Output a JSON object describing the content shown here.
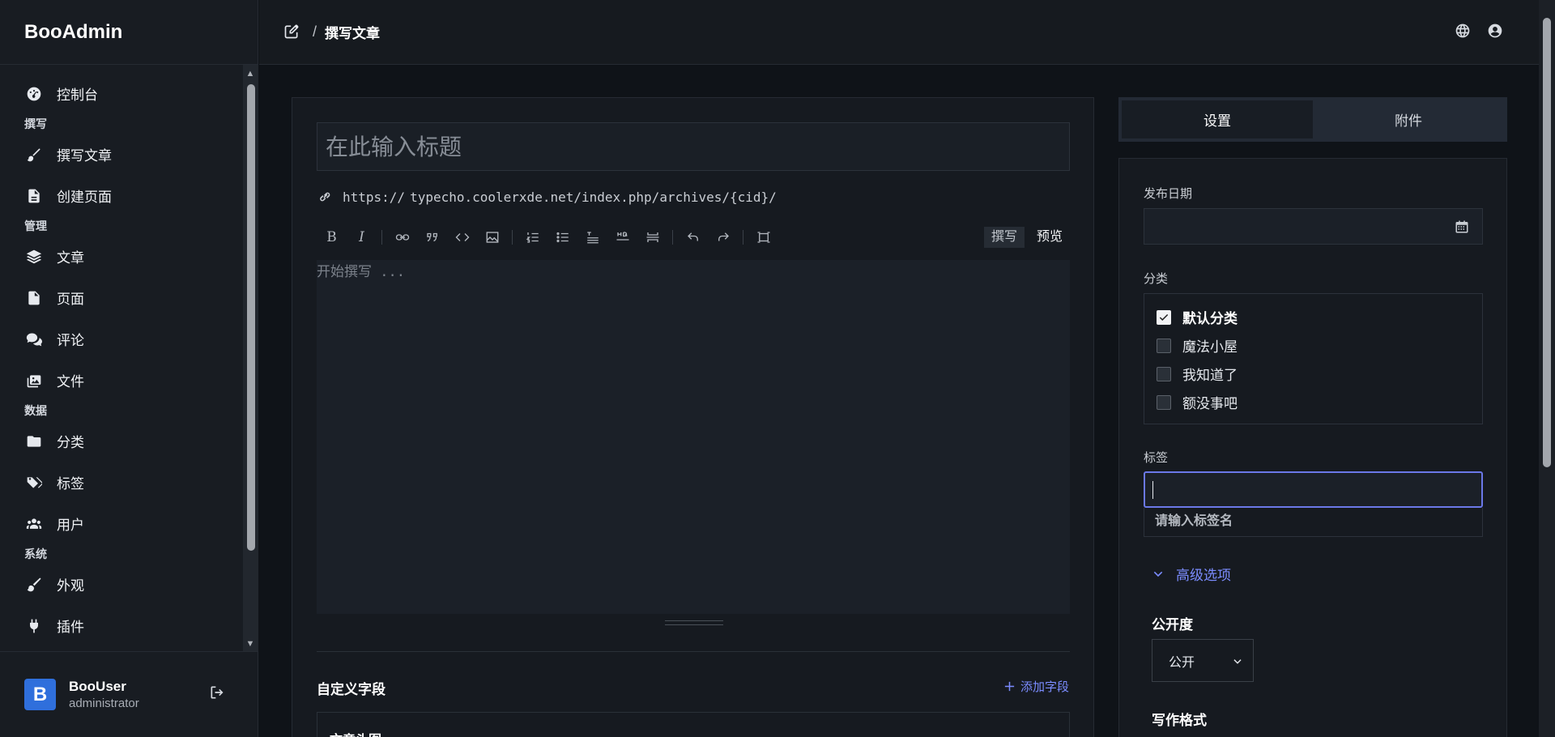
{
  "brand": "BooAdmin",
  "sidebar": {
    "items": [
      {
        "label": "控制台",
        "icon": "dashboard-icon"
      },
      {
        "group": "撰写"
      },
      {
        "label": "撰写文章",
        "icon": "brush-icon"
      },
      {
        "label": "创建页面",
        "icon": "document-icon"
      },
      {
        "group": "管理"
      },
      {
        "label": "文章",
        "icon": "layers-icon"
      },
      {
        "label": "页面",
        "icon": "file-icon"
      },
      {
        "label": "评论",
        "icon": "comments-icon"
      },
      {
        "label": "文件",
        "icon": "images-icon"
      },
      {
        "group": "数据"
      },
      {
        "label": "分类",
        "icon": "folder-icon"
      },
      {
        "label": "标签",
        "icon": "tags-icon"
      },
      {
        "label": "用户",
        "icon": "users-icon"
      },
      {
        "group": "系统"
      },
      {
        "label": "外观",
        "icon": "paint-icon"
      },
      {
        "label": "插件",
        "icon": "plug-icon"
      }
    ]
  },
  "user": {
    "avatar_letter": "B",
    "name": "BooUser",
    "role": "administrator"
  },
  "header": {
    "separator": "/",
    "title": "撰写文章"
  },
  "editor": {
    "title_placeholder": "在此输入标题",
    "permalink_prefix": "https://",
    "permalink_path": "typecho.coolerxde.net/index.php/archives/{cid}/",
    "toolbar": {
      "bold": "B",
      "italic": "I",
      "write_mode": "撰写",
      "preview_mode": "预览"
    },
    "body_placeholder": "开始撰写 ...",
    "custom_fields_title": "自定义字段",
    "add_field": "添加字段",
    "custom_field_first": "文章头图"
  },
  "settings": {
    "tabs": [
      "设置",
      "附件"
    ],
    "publish_date_label": "发布日期",
    "category_label": "分类",
    "categories": [
      {
        "name": "默认分类",
        "checked": true
      },
      {
        "name": "魔法小屋",
        "checked": false
      },
      {
        "name": "我知道了",
        "checked": false
      },
      {
        "name": "额没事吧",
        "checked": false
      }
    ],
    "tags_label": "标签",
    "tags_hint": "请输入标签名",
    "advanced_label": "高级选项",
    "visibility_label": "公开度",
    "visibility_value": "公开",
    "format_label": "写作格式"
  },
  "colors": {
    "accent": "#7b8cff",
    "avatar": "#2f6fdc",
    "background": "#0f1318"
  }
}
